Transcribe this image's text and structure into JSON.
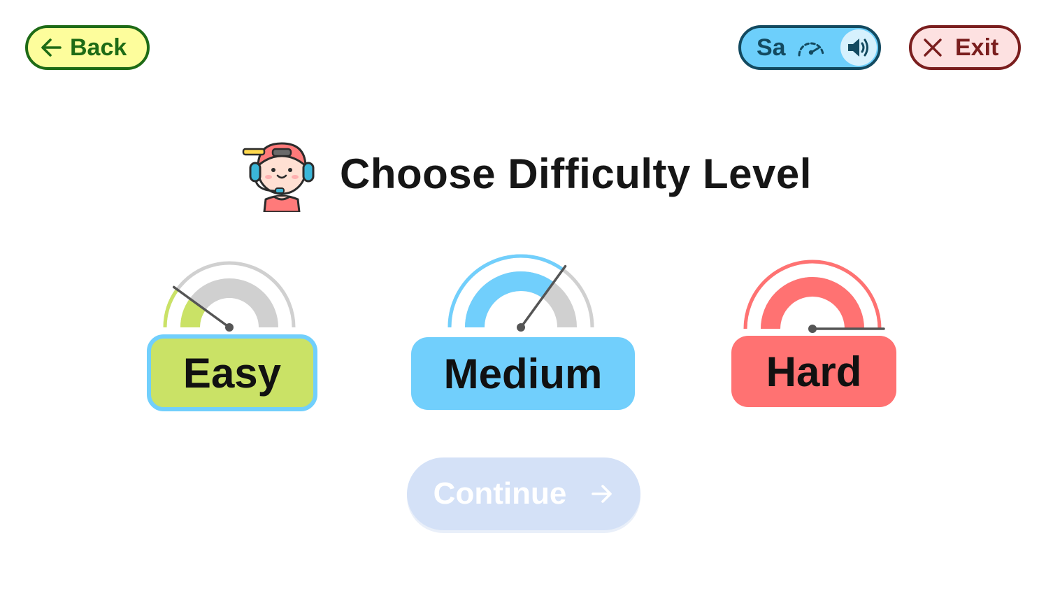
{
  "header": {
    "back_label": "Back",
    "exit_label": "Exit",
    "speech_sample": "Sa"
  },
  "title": "Choose Difficulty Level",
  "levels": [
    {
      "label": "Easy",
      "gauge_fraction": 0.2,
      "color": "#cae266",
      "selected": true
    },
    {
      "label": "Medium",
      "gauge_fraction": 0.7,
      "color": "#71cffc",
      "selected": false
    },
    {
      "label": "Hard",
      "gauge_fraction": 1.0,
      "color": "#ff7272",
      "selected": false
    }
  ],
  "continue_label": "Continue",
  "continue_enabled": false,
  "colors": {
    "back_bg": "#fdfd9c",
    "back_border": "#1e6b16",
    "exit_bg": "#fde1e1",
    "exit_border": "#7a1e1e",
    "speech_bg": "#6dcffb",
    "speech_border": "#134a60",
    "selected_border": "#71cffc",
    "gauge_track": "#d0d0d0",
    "needle": "#555555"
  },
  "icons": [
    "arrow-left-icon",
    "speed-gauge-icon",
    "speaker-icon",
    "close-icon",
    "arrow-right-icon",
    "gamer-avatar-icon"
  ]
}
